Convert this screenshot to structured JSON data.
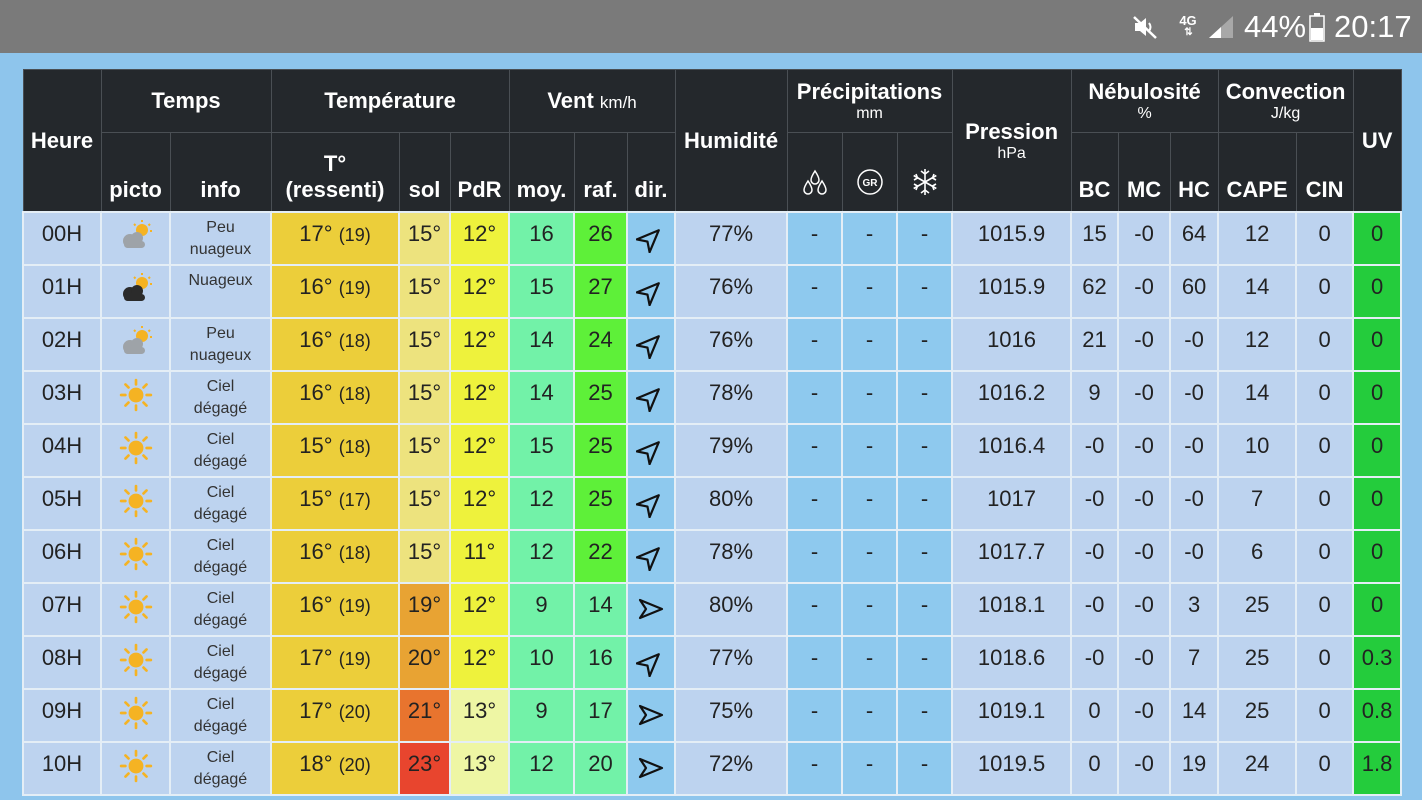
{
  "status_bar": {
    "mute_icon": "volume-mute-icon",
    "network": "4G",
    "signal_icon": "signal-icon",
    "battery_pct": "44%",
    "battery_icon": "battery-icon",
    "time": "20:17"
  },
  "header": {
    "heure": "Heure",
    "temps": "Temps",
    "picto": "picto",
    "info": "info",
    "temperature": "Température",
    "t_label": "T°",
    "t_ressenti": "(ressenti)",
    "sol": "sol",
    "pdr": "PdR",
    "vent": "Vent",
    "vent_unit": "km/h",
    "moy": "moy.",
    "raf": "raf.",
    "dir": "dir.",
    "humidite": "Humidité",
    "precipitations": "Précipitations",
    "precip_unit": "mm",
    "precip_icons": [
      "rain-drops-icon",
      "hail-icon",
      "snowflake-icon"
    ],
    "hail_label": "GR",
    "pression": "Pression",
    "pression_unit": "hPa",
    "nebulosite": "Nébulosité",
    "neb_unit": "%",
    "bc": "BC",
    "mc": "MC",
    "hc": "HC",
    "convection": "Convection",
    "conv_unit": "J/kg",
    "cape": "CAPE",
    "cin": "CIN",
    "uv": "UV"
  },
  "colors": {
    "header_bg": "#24282c",
    "row_bg": "#bdd3ef",
    "precip_bg": "#8ec9ee",
    "temp_bg": "#ecce3a",
    "uv_bg": "#24cc3c"
  },
  "rows": [
    {
      "heure": "00H",
      "icon": "partly-cloudy-icon",
      "info": [
        "Peu",
        "nuageux"
      ],
      "temp": "17°",
      "feel": "(19)",
      "sol": "15°",
      "pdr": "12°",
      "moy": "16",
      "raf": "26",
      "dir_icon": "wind-arrow-sw-icon",
      "dir_angle": 225,
      "humidite": "77%",
      "rain": "-",
      "hail": "-",
      "snow": "-",
      "pression": "1015.9",
      "bc": "15",
      "mc": "-0",
      "hc": "64",
      "cape": "12",
      "cin": "0",
      "uv": "0",
      "sol_color": "#ede37e",
      "pdr_color": "#eef23c",
      "raf_color": "#5ef039"
    },
    {
      "heure": "01H",
      "icon": "cloudy-dark-icon",
      "info": [
        "Nuageux"
      ],
      "temp": "16°",
      "feel": "(19)",
      "sol": "15°",
      "pdr": "12°",
      "moy": "15",
      "raf": "27",
      "dir_icon": "wind-arrow-sw-icon",
      "dir_angle": 225,
      "humidite": "76%",
      "rain": "-",
      "hail": "-",
      "snow": "-",
      "pression": "1015.9",
      "bc": "62",
      "mc": "-0",
      "hc": "60",
      "cape": "14",
      "cin": "0",
      "uv": "0",
      "sol_color": "#ede37e",
      "pdr_color": "#eef23c",
      "raf_color": "#5ef039"
    },
    {
      "heure": "02H",
      "icon": "partly-cloudy-icon",
      "info": [
        "Peu",
        "nuageux"
      ],
      "temp": "16°",
      "feel": "(18)",
      "sol": "15°",
      "pdr": "12°",
      "moy": "14",
      "raf": "24",
      "dir_icon": "wind-arrow-sw-icon",
      "dir_angle": 225,
      "humidite": "76%",
      "rain": "-",
      "hail": "-",
      "snow": "-",
      "pression": "1016",
      "bc": "21",
      "mc": "-0",
      "hc": "-0",
      "cape": "12",
      "cin": "0",
      "uv": "0",
      "sol_color": "#ede37e",
      "pdr_color": "#eef23c",
      "raf_color": "#5ef039"
    },
    {
      "heure": "03H",
      "icon": "sun-icon",
      "info": [
        "Ciel",
        "dégagé"
      ],
      "temp": "16°",
      "feel": "(18)",
      "sol": "15°",
      "pdr": "12°",
      "moy": "14",
      "raf": "25",
      "dir_icon": "wind-arrow-sw-icon",
      "dir_angle": 225,
      "humidite": "78%",
      "rain": "-",
      "hail": "-",
      "snow": "-",
      "pression": "1016.2",
      "bc": "9",
      "mc": "-0",
      "hc": "-0",
      "cape": "14",
      "cin": "0",
      "uv": "0",
      "sol_color": "#ede37e",
      "pdr_color": "#eef23c",
      "raf_color": "#5ef039"
    },
    {
      "heure": "04H",
      "icon": "sun-icon",
      "info": [
        "Ciel",
        "dégagé"
      ],
      "temp": "15°",
      "feel": "(18)",
      "sol": "15°",
      "pdr": "12°",
      "moy": "15",
      "raf": "25",
      "dir_icon": "wind-arrow-sw-icon",
      "dir_angle": 225,
      "humidite": "79%",
      "rain": "-",
      "hail": "-",
      "snow": "-",
      "pression": "1016.4",
      "bc": "-0",
      "mc": "-0",
      "hc": "-0",
      "cape": "10",
      "cin": "0",
      "uv": "0",
      "sol_color": "#ede37e",
      "pdr_color": "#eef23c",
      "raf_color": "#5ef039"
    },
    {
      "heure": "05H",
      "icon": "sun-icon",
      "info": [
        "Ciel",
        "dégagé"
      ],
      "temp": "15°",
      "feel": "(17)",
      "sol": "15°",
      "pdr": "12°",
      "moy": "12",
      "raf": "25",
      "dir_icon": "wind-arrow-sw-icon",
      "dir_angle": 225,
      "humidite": "80%",
      "rain": "-",
      "hail": "-",
      "snow": "-",
      "pression": "1017",
      "bc": "-0",
      "mc": "-0",
      "hc": "-0",
      "cape": "7",
      "cin": "0",
      "uv": "0",
      "sol_color": "#ede37e",
      "pdr_color": "#eef23c",
      "raf_color": "#5ef039"
    },
    {
      "heure": "06H",
      "icon": "sun-icon",
      "info": [
        "Ciel",
        "dégagé"
      ],
      "temp": "16°",
      "feel": "(18)",
      "sol": "15°",
      "pdr": "11°",
      "moy": "12",
      "raf": "22",
      "dir_icon": "wind-arrow-sw-icon",
      "dir_angle": 225,
      "humidite": "78%",
      "rain": "-",
      "hail": "-",
      "snow": "-",
      "pression": "1017.7",
      "bc": "-0",
      "mc": "-0",
      "hc": "-0",
      "cape": "6",
      "cin": "0",
      "uv": "0",
      "sol_color": "#ede37e",
      "pdr_color": "#eef23c",
      "raf_color": "#5ef039"
    },
    {
      "heure": "07H",
      "icon": "sun-icon",
      "info": [
        "Ciel",
        "dégagé"
      ],
      "temp": "16°",
      "feel": "(19)",
      "sol": "19°",
      "pdr": "12°",
      "moy": "9",
      "raf": "14",
      "dir_icon": "wind-arrow-w-icon",
      "dir_angle": 270,
      "humidite": "80%",
      "rain": "-",
      "hail": "-",
      "snow": "-",
      "pression": "1018.1",
      "bc": "-0",
      "mc": "-0",
      "hc": "3",
      "cape": "25",
      "cin": "0",
      "uv": "0",
      "sol_color": "#e8a333",
      "pdr_color": "#eef23c",
      "raf_color": "#72f2a8"
    },
    {
      "heure": "08H",
      "icon": "sun-icon",
      "info": [
        "Ciel",
        "dégagé"
      ],
      "temp": "17°",
      "feel": "(19)",
      "sol": "20°",
      "pdr": "12°",
      "moy": "10",
      "raf": "16",
      "dir_icon": "wind-arrow-sw-icon",
      "dir_angle": 225,
      "humidite": "77%",
      "rain": "-",
      "hail": "-",
      "snow": "-",
      "pression": "1018.6",
      "bc": "-0",
      "mc": "-0",
      "hc": "7",
      "cape": "25",
      "cin": "0",
      "uv": "0.3",
      "sol_color": "#e8a333",
      "pdr_color": "#eef23c",
      "raf_color": "#72f2a8"
    },
    {
      "heure": "09H",
      "icon": "sun-icon",
      "info": [
        "Ciel",
        "dégagé"
      ],
      "temp": "17°",
      "feel": "(20)",
      "sol": "21°",
      "pdr": "13°",
      "moy": "9",
      "raf": "17",
      "dir_icon": "wind-arrow-w-icon",
      "dir_angle": 270,
      "humidite": "75%",
      "rain": "-",
      "hail": "-",
      "snow": "-",
      "pression": "1019.1",
      "bc": "0",
      "mc": "-0",
      "hc": "14",
      "cape": "25",
      "cin": "0",
      "uv": "0.8",
      "sol_color": "#e8742e",
      "pdr_color": "#eef6a4",
      "raf_color": "#72f2a8"
    },
    {
      "heure": "10H",
      "icon": "sun-icon",
      "info": [
        "Ciel",
        "dégagé"
      ],
      "temp": "18°",
      "feel": "(20)",
      "sol": "23°",
      "pdr": "13°",
      "moy": "12",
      "raf": "20",
      "dir_icon": "wind-arrow-w-icon",
      "dir_angle": 270,
      "humidite": "72%",
      "rain": "-",
      "hail": "-",
      "snow": "-",
      "pression": "1019.5",
      "bc": "0",
      "mc": "-0",
      "hc": "19",
      "cape": "24",
      "cin": "0",
      "uv": "1.8",
      "sol_color": "#e8452e",
      "pdr_color": "#eef6a4",
      "raf_color": "#72f2a8"
    }
  ]
}
